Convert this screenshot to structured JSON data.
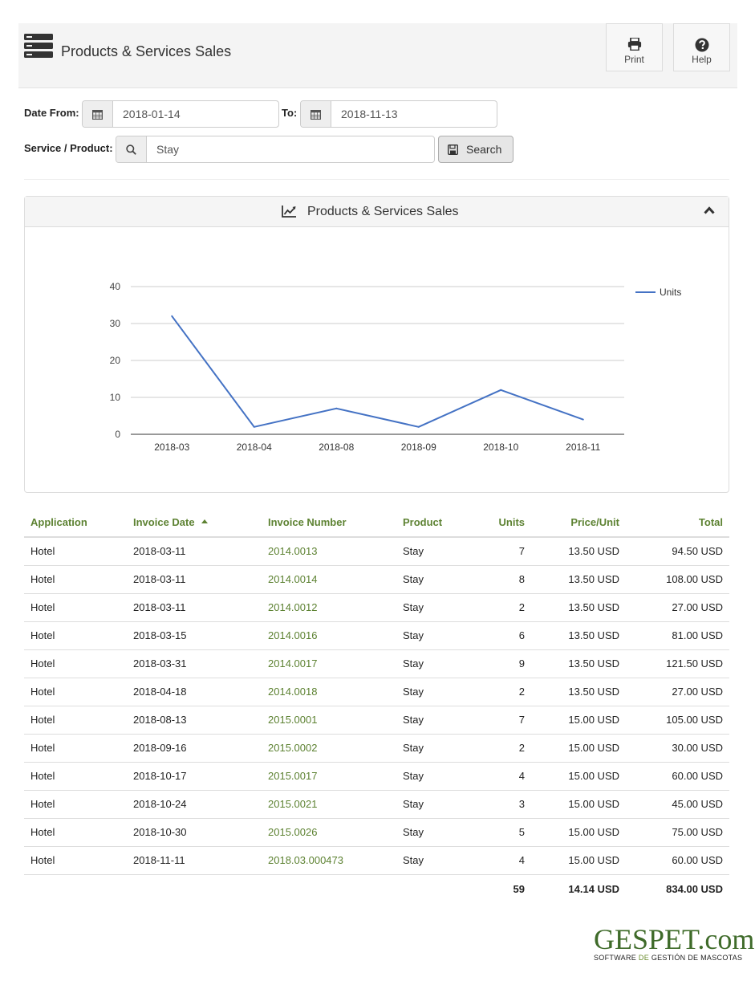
{
  "header": {
    "title": "Products & Services Sales",
    "print_label": "Print",
    "help_label": "Help"
  },
  "filters": {
    "date_from_label": "Date From:",
    "date_from_value": "2018-01-14",
    "to_label": "To:",
    "to_value": "2018-11-13",
    "service_label": "Service / Product:",
    "service_value": "Stay",
    "search_label": "Search"
  },
  "panel": {
    "title": "Products & Services Sales"
  },
  "chart_data": {
    "type": "line",
    "categories": [
      "2018-03",
      "2018-04",
      "2018-08",
      "2018-09",
      "2018-10",
      "2018-11"
    ],
    "series": [
      {
        "name": "Units",
        "values": [
          32,
          2,
          7,
          2,
          12,
          4
        ],
        "color": "#4472c4"
      }
    ],
    "yticks": [
      0,
      10,
      20,
      30,
      40
    ],
    "ylim": [
      0,
      40
    ],
    "grid": true,
    "legend_position": "top-right"
  },
  "table": {
    "headers": [
      "Application",
      "Invoice Date",
      "Invoice Number",
      "Product",
      "Units",
      "Price/Unit",
      "Total"
    ],
    "rows": [
      [
        "Hotel",
        "2018-03-11",
        "2014.0013",
        "Stay",
        "7",
        "13.50 USD",
        "94.50 USD"
      ],
      [
        "Hotel",
        "2018-03-11",
        "2014.0014",
        "Stay",
        "8",
        "13.50 USD",
        "108.00 USD"
      ],
      [
        "Hotel",
        "2018-03-11",
        "2014.0012",
        "Stay",
        "2",
        "13.50 USD",
        "27.00 USD"
      ],
      [
        "Hotel",
        "2018-03-15",
        "2014.0016",
        "Stay",
        "6",
        "13.50 USD",
        "81.00 USD"
      ],
      [
        "Hotel",
        "2018-03-31",
        "2014.0017",
        "Stay",
        "9",
        "13.50 USD",
        "121.50 USD"
      ],
      [
        "Hotel",
        "2018-04-18",
        "2014.0018",
        "Stay",
        "2",
        "13.50 USD",
        "27.00 USD"
      ],
      [
        "Hotel",
        "2018-08-13",
        "2015.0001",
        "Stay",
        "7",
        "15.00 USD",
        "105.00 USD"
      ],
      [
        "Hotel",
        "2018-09-16",
        "2015.0002",
        "Stay",
        "2",
        "15.00 USD",
        "30.00 USD"
      ],
      [
        "Hotel",
        "2018-10-17",
        "2015.0017",
        "Stay",
        "4",
        "15.00 USD",
        "60.00 USD"
      ],
      [
        "Hotel",
        "2018-10-24",
        "2015.0021",
        "Stay",
        "3",
        "15.00 USD",
        "45.00 USD"
      ],
      [
        "Hotel",
        "2018-10-30",
        "2015.0026",
        "Stay",
        "5",
        "15.00 USD",
        "75.00 USD"
      ],
      [
        "Hotel",
        "2018-11-11",
        "2018.03.000473",
        "Stay",
        "4",
        "15.00 USD",
        "60.00 USD"
      ]
    ],
    "totals": {
      "units": "59",
      "price": "14.14 USD",
      "total": "834.00 USD"
    }
  },
  "footer": {
    "logo_text": "GESPET.com",
    "tagline_1": "SOFTWARE",
    "tagline_2": "DE",
    "tagline_3": "GESTIÓN DE MASCOTAS"
  },
  "colors": {
    "accent_green": "#5d8232",
    "line_blue": "#4472c4"
  }
}
